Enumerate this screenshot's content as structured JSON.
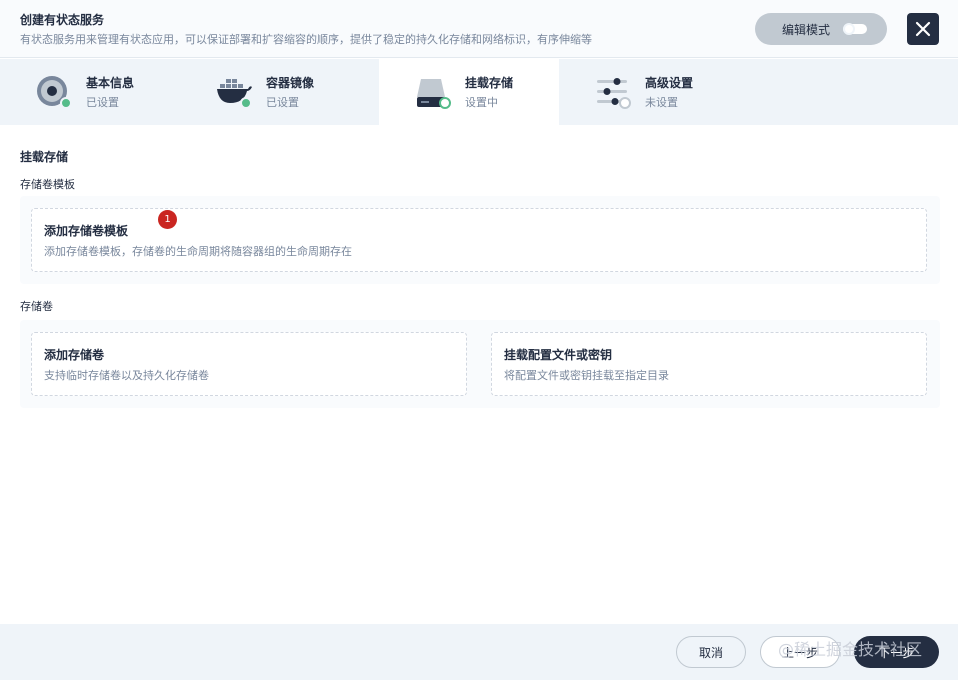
{
  "header": {
    "title": "创建有状态服务",
    "description": "有状态服务用来管理有状态应用，可以保证部署和扩容缩容的顺序，提供了稳定的持久化存储和网络标识，有序伸缩等",
    "edit_mode_label": "编辑模式"
  },
  "steps": [
    {
      "name": "基本信息",
      "status": "已设置",
      "icon": "basic-info-icon"
    },
    {
      "name": "容器镜像",
      "status": "已设置",
      "icon": "docker-icon"
    },
    {
      "name": "挂载存储",
      "status": "设置中",
      "icon": "storage-icon"
    },
    {
      "name": "高级设置",
      "status": "未设置",
      "icon": "settings-sliders-icon"
    }
  ],
  "content": {
    "section_title": "挂载存储",
    "volume_templates": {
      "label": "存储卷模板",
      "add_card": {
        "title": "添加存储卷模板",
        "desc": "添加存储卷模板，存储卷的生命周期将随容器组的生命周期存在"
      },
      "badge_count": "1"
    },
    "volumes": {
      "label": "存储卷",
      "add_volume": {
        "title": "添加存储卷",
        "desc": "支持临时存储卷以及持久化存储卷"
      },
      "mount_config": {
        "title": "挂载配置文件或密钥",
        "desc": "将配置文件或密钥挂载至指定目录"
      }
    }
  },
  "footer": {
    "cancel_label": "取消",
    "prev_label": "上一步",
    "next_label": "下一步",
    "watermark": "@稀土掘金技术社区"
  },
  "colors": {
    "primary_dark": "#242e42",
    "success_green": "#55bc8a",
    "badge_red": "#ca2621",
    "step_bg": "#eff4f9"
  }
}
